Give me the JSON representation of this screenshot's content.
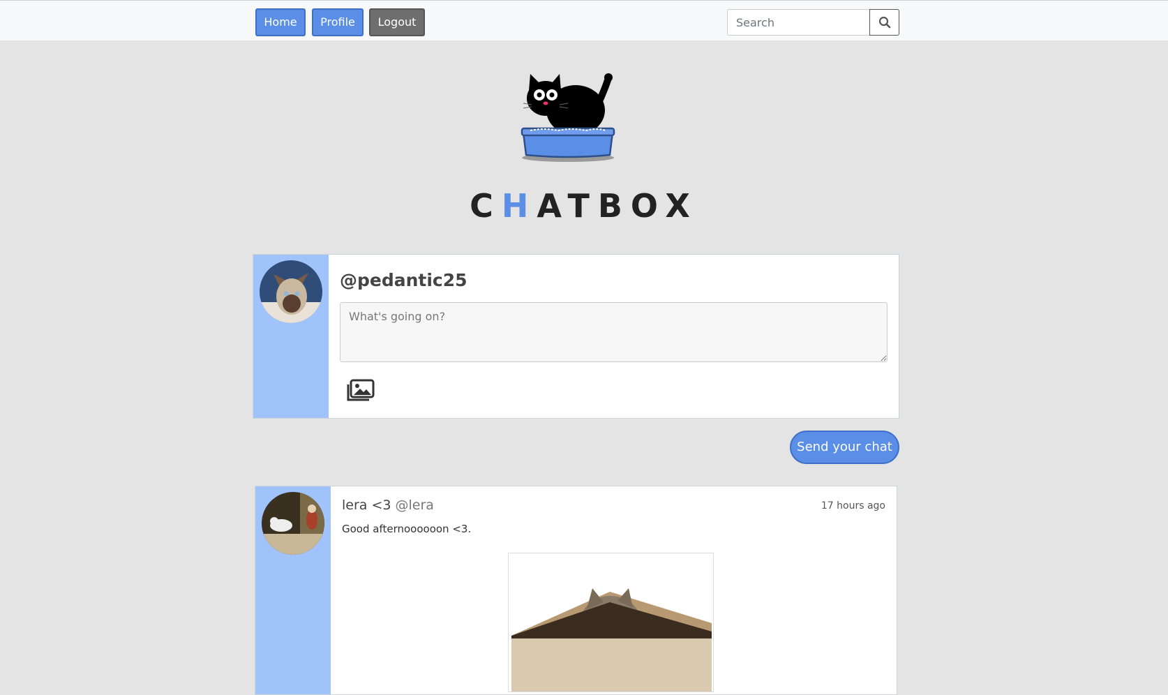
{
  "nav": {
    "home_label": "Home",
    "profile_label": "Profile",
    "logout_label": "Logout",
    "search_placeholder": "Search"
  },
  "brand": {
    "letter_1": "C",
    "highlight": "H",
    "rest": "ATBOX"
  },
  "compose": {
    "username": "@pedantic25",
    "placeholder": "What's going on?",
    "send_label": "Send your chat"
  },
  "posts": [
    {
      "display_name": "lera <3",
      "handle": "@lera",
      "time": "17 hours ago",
      "text": "Good afternoooooon <3."
    }
  ],
  "colors": {
    "accent": "#5b8ee6",
    "sidebar": "#a0c3fb",
    "background": "#e4e4e4"
  }
}
